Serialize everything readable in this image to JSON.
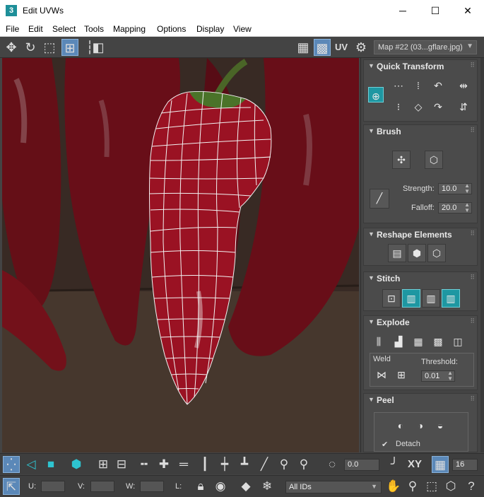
{
  "window": {
    "title": "Edit UVWs",
    "app_icon_text": "3",
    "minimize_glyph": "─",
    "maximize_glyph": "☐",
    "close_glyph": "✕"
  },
  "menu": {
    "items": [
      "File",
      "Edit",
      "Select",
      "Tools",
      "Mapping",
      "Options",
      "Display",
      "View"
    ]
  },
  "top_toolbar": {
    "uv_label": "UV",
    "map_selector": "Map #22 (03...gflare.jpg)"
  },
  "panel": {
    "quick_transform": {
      "title": "Quick Transform"
    },
    "brush": {
      "title": "Brush",
      "strength_label": "Strength:",
      "strength_value": "10.0",
      "falloff_label": "Falloff:",
      "falloff_value": "20.0"
    },
    "reshape": {
      "title": "Reshape Elements"
    },
    "stitch": {
      "title": "Stitch"
    },
    "explode": {
      "title": "Explode",
      "weld_label": "Weld",
      "threshold_label": "Threshold:",
      "threshold_value": "0.01"
    },
    "peel": {
      "title": "Peel",
      "detach_label": "Detach"
    }
  },
  "bottom_toolbar": {
    "angle_value": "0.0",
    "xy_label": "XY",
    "grid_value": "16",
    "u_label": "U:",
    "v_label": "V:",
    "w_label": "W:",
    "l_label": "L:",
    "ids_selector": "All IDs"
  },
  "colors": {
    "accent_blue": "#5b88b8",
    "teal": "#1e97a2",
    "pepper_red": "#a31425"
  }
}
